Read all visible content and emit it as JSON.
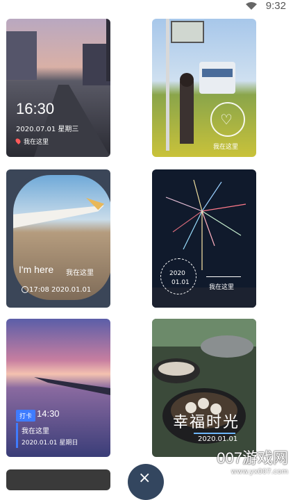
{
  "status_bar": {
    "time": "9:32",
    "wifi_icon": "wifi-icon"
  },
  "cards": [
    {
      "time": "16:30",
      "date": "2020.07.01 星期三",
      "location": "我在这里"
    },
    {
      "location": "我在这里"
    },
    {
      "title_en": "I'm here",
      "title_cn": "我在这里",
      "date": "17:08 2020.01.01"
    },
    {
      "circle_year": "2020",
      "circle_md": "01.01",
      "location": "我在这里"
    },
    {
      "tag": "打卡",
      "time": "14:30",
      "location": "我在这里",
      "date": "2020.01.01 星期日"
    },
    {
      "title": "幸福时光",
      "date": "2020.01.01"
    }
  ],
  "fab": {
    "icon": "close-icon",
    "glyph": "×"
  },
  "watermark": {
    "main": "007游戏网",
    "url": "www.yx007.com"
  }
}
